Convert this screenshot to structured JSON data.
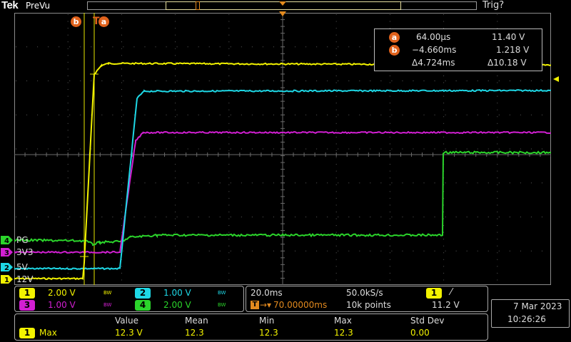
{
  "header": {
    "brand": "Tek",
    "mode": "PreVu",
    "trigger_status": "Trig?"
  },
  "channels": [
    {
      "num": "1",
      "label": "12V",
      "color": "#f2f200",
      "scale": "2.00 V",
      "bw": "BW"
    },
    {
      "num": "2",
      "label": "5V",
      "color": "#1ed8e6",
      "scale": "1.00 V",
      "bw": "BW"
    },
    {
      "num": "3",
      "label": "3V3",
      "color": "#d21fd2",
      "scale": "1.00 V",
      "bw": "BW"
    },
    {
      "num": "4",
      "label": "PG",
      "color": "#2bd42b",
      "scale": "2.00 V",
      "bw": "BW"
    }
  ],
  "cursors": {
    "a_label": "a",
    "b_label": "b",
    "t_label": "T",
    "a_time": "64.00µs",
    "a_volt": "11.40 V",
    "b_time": "−4.660ms",
    "b_volt": "1.218 V",
    "delta_time": "Δ4.724ms",
    "delta_volt": "Δ10.18 V"
  },
  "timebase": {
    "scale": "20.0ms",
    "sample_rate": "50.0kS/s",
    "position": "70.00000ms",
    "record": "10k points"
  },
  "trigger": {
    "source": "1",
    "slope": "⁄",
    "level": "11.2 V"
  },
  "datetime": {
    "date": "7 Mar  2023",
    "time": "10:26:26"
  },
  "measurements": {
    "headers": [
      "Value",
      "Mean",
      "Min",
      "Max",
      "Std Dev"
    ],
    "rows": [
      {
        "source": "1",
        "name": "Max",
        "values": [
          "12.3 V",
          "12.3",
          "12.3",
          "12.3",
          "0.00"
        ]
      }
    ]
  }
}
